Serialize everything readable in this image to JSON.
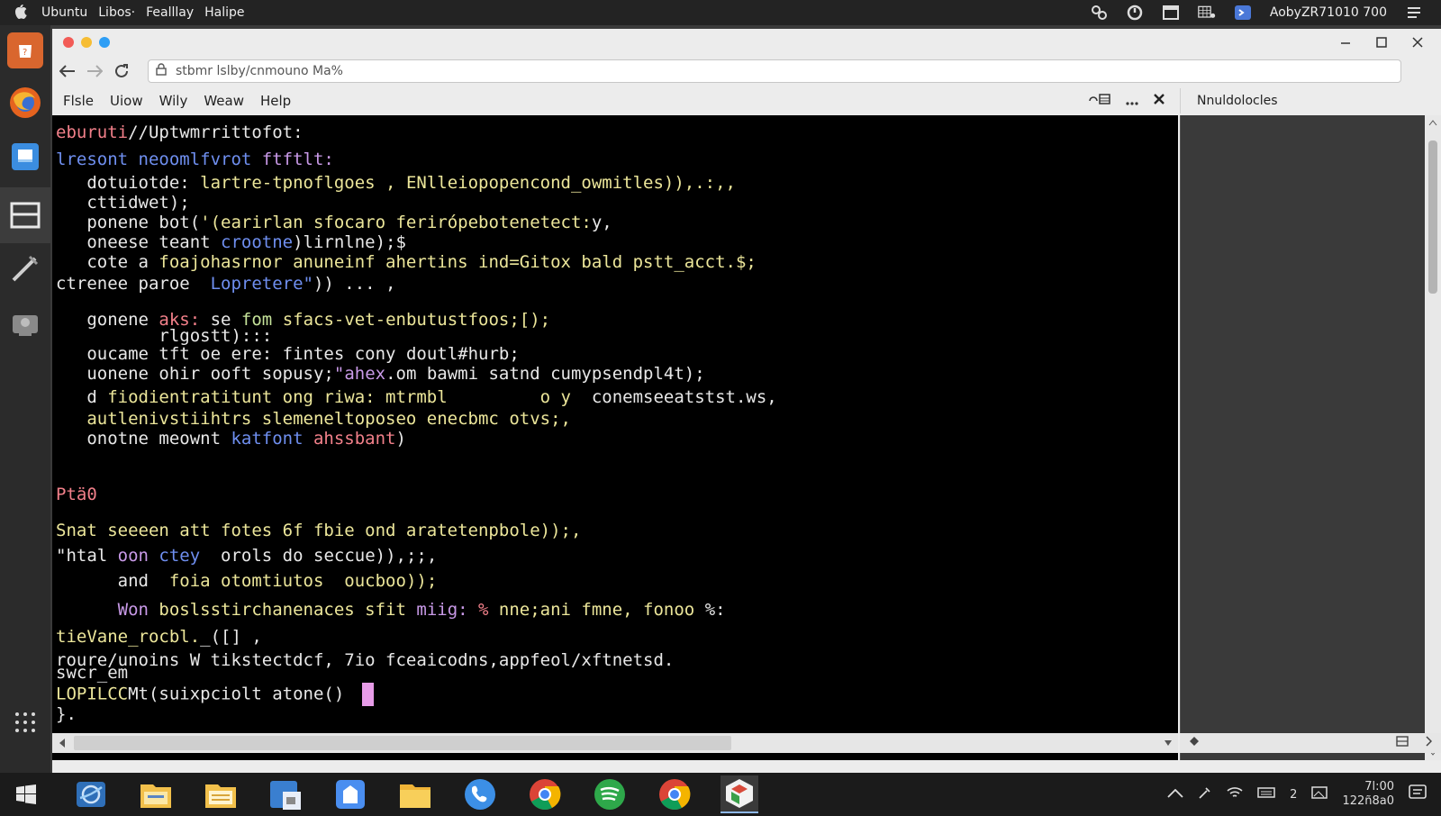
{
  "system_bar": {
    "menus": [
      "Ubuntu",
      "Libos·",
      "Fealllay",
      "Halipe"
    ],
    "status_text": "AobyZR71010 700"
  },
  "window": {
    "url": "stbmr lslby/cnmouno Ma%",
    "menus": [
      "Flsle",
      "Uiow",
      "Wily",
      "Weaw",
      "Help"
    ],
    "side_title": "Nnuldolocles"
  },
  "terminal": {
    "colors": {
      "pink": "#f2808a",
      "blue": "#6f8ff0",
      "white": "#e8e8e8",
      "yellow": "#ece69a",
      "green": "#c6e39a",
      "purple": "#c99ae8",
      "cyan": "#8fc8f0",
      "orange": "#f2b46e",
      "cursor": "#e79ce8"
    },
    "lines": [
      {
        "segs": [
          {
            "t": "eburuti",
            "c": "pink"
          },
          {
            "t": "//Uptwmrrittofot:",
            "c": "white"
          }
        ]
      },
      {
        "segs": [
          {
            "t": "lresont neoomlfvrot ",
            "c": "blue"
          },
          {
            "t": "ftftlt:",
            "c": "purple"
          }
        ]
      },
      {
        "segs": [
          {
            "t": "   dotuiotde: ",
            "c": "white"
          },
          {
            "t": "lartre-tpnoflgoes , ",
            "c": "yellow"
          },
          {
            "t": "ENlleiopopencond_owmitles)),.:,,",
            "c": "yellow"
          }
        ]
      },
      {
        "segs": [
          {
            "t": "   cttidwet);",
            "c": "white"
          }
        ]
      },
      {
        "segs": [
          {
            "t": "   ponene bot(",
            "c": "white"
          },
          {
            "t": "'(earirlan sfocaro ferirópebotenetect:",
            "c": "yellow"
          },
          {
            "t": "y,",
            "c": "white"
          }
        ]
      },
      {
        "segs": [
          {
            "t": "   oneese teant ",
            "c": "white"
          },
          {
            "t": "crootne",
            "c": "blue"
          },
          {
            "t": ")lirnlne);$",
            "c": "white"
          }
        ]
      },
      {
        "segs": [
          {
            "t": "   cote a ",
            "c": "white"
          },
          {
            "t": "foajohasrnor anuneinf ahertins ind=Gitox bald pstt_acct.$;",
            "c": "yellow"
          }
        ]
      },
      {
        "segs": [
          {
            "t": "ctrenee paroe  ",
            "c": "white"
          },
          {
            "t": "Lopretere\"",
            "c": "blue"
          },
          {
            "t": ")) ... ,",
            "c": "white"
          }
        ]
      },
      {
        "segs": [
          {
            "t": "   gonene ",
            "c": "white"
          },
          {
            "t": "aks: ",
            "c": "pink"
          },
          {
            "t": "se ",
            "c": "white"
          },
          {
            "t": "fom ",
            "c": "green"
          },
          {
            "t": "sfacs-vet-enbutustfoos;[);",
            "c": "yellow"
          }
        ]
      },
      {
        "segs": [
          {
            "t": "          rlgostt):::",
            "c": "white"
          }
        ]
      },
      {
        "segs": [
          {
            "t": "   oucame ",
            "c": "white"
          },
          {
            "t": "tft ",
            "c": "white"
          },
          {
            "t": "oe ere: ",
            "c": "white"
          },
          {
            "t": "fintes cony doutl#hurb;",
            "c": "white"
          }
        ]
      },
      {
        "segs": [
          {
            "t": "   uonene ohir ",
            "c": "white"
          },
          {
            "t": "ooft sopusy;",
            "c": "white"
          },
          {
            "t": "\"ahex",
            "c": "purple"
          },
          {
            "t": ".om bawmi satnd cumypsendpl4t);",
            "c": "white"
          }
        ]
      },
      {
        "segs": [
          {
            "t": "   d ",
            "c": "white"
          },
          {
            "t": "fiodientratitunt ong riwa: mtrmbl         o y  ",
            "c": "yellow"
          },
          {
            "t": "conemseeatstst.ws,",
            "c": "white"
          }
        ]
      },
      {
        "segs": [
          {
            "t": "   autlenivstiihtrs slemeneltoposeo enecbmc otvs;,",
            "c": "yellow"
          }
        ]
      },
      {
        "segs": [
          {
            "t": "   onotne meownt ",
            "c": "white"
          },
          {
            "t": "katfont ",
            "c": "blue"
          },
          {
            "t": "ahssbant",
            "c": "pink"
          },
          {
            "t": ")",
            "c": "white"
          }
        ]
      },
      {
        "segs": [
          {
            "t": "Ptä0",
            "c": "pink"
          }
        ]
      },
      {
        "segs": [
          {
            "t": "Snat seeeen att fotes 6f fbie ond aratetenpbole));,",
            "c": "yellow"
          }
        ]
      },
      {
        "segs": [
          {
            "t": "\"htal ",
            "c": "white"
          },
          {
            "t": "oon ",
            "c": "purple"
          },
          {
            "t": "ctey",
            "c": "blue"
          },
          {
            "t": "  orols do seccue)),;;,",
            "c": "white"
          }
        ]
      },
      {
        "segs": [
          {
            "t": "      and  ",
            "c": "white"
          },
          {
            "t": "foia otomtiutos  oucboo));",
            "c": "yellow"
          }
        ]
      },
      {
        "segs": [
          {
            "t": "      Won ",
            "c": "purple"
          },
          {
            "t": "boslsstirchanenaces sfit ",
            "c": "yellow"
          },
          {
            "t": "miig: ",
            "c": "purple"
          },
          {
            "t": "% ",
            "c": "pink"
          },
          {
            "t": "nne;ani fmne, fonoo ",
            "c": "yellow"
          },
          {
            "t": "%:",
            "c": "white"
          }
        ]
      },
      {
        "segs": [
          {
            "t": "tieVane_rocbl.",
            "c": "yellow"
          },
          {
            "t": "_([] ,",
            "c": "white"
          }
        ]
      },
      {
        "segs": [
          {
            "t": "roure/unoins W tikstectdcf, 7io fceaicodns,appfeol/xftnetsd.",
            "c": "white"
          }
        ]
      },
      {
        "segs": [
          {
            "t": "swcr_em",
            "c": "white"
          }
        ]
      },
      {
        "segs": [
          {
            "t": "LOPILCC",
            "c": "yellow"
          },
          {
            "t": "Mt(suixpciolt atone() ",
            "c": "white"
          }
        ],
        "cursor": true
      },
      {
        "segs": [
          {
            "t": "}.",
            "c": "white"
          }
        ]
      }
    ]
  },
  "taskbar": {
    "time": "7l:00",
    "date": "122ñ8a0",
    "tray_badge": "2"
  }
}
